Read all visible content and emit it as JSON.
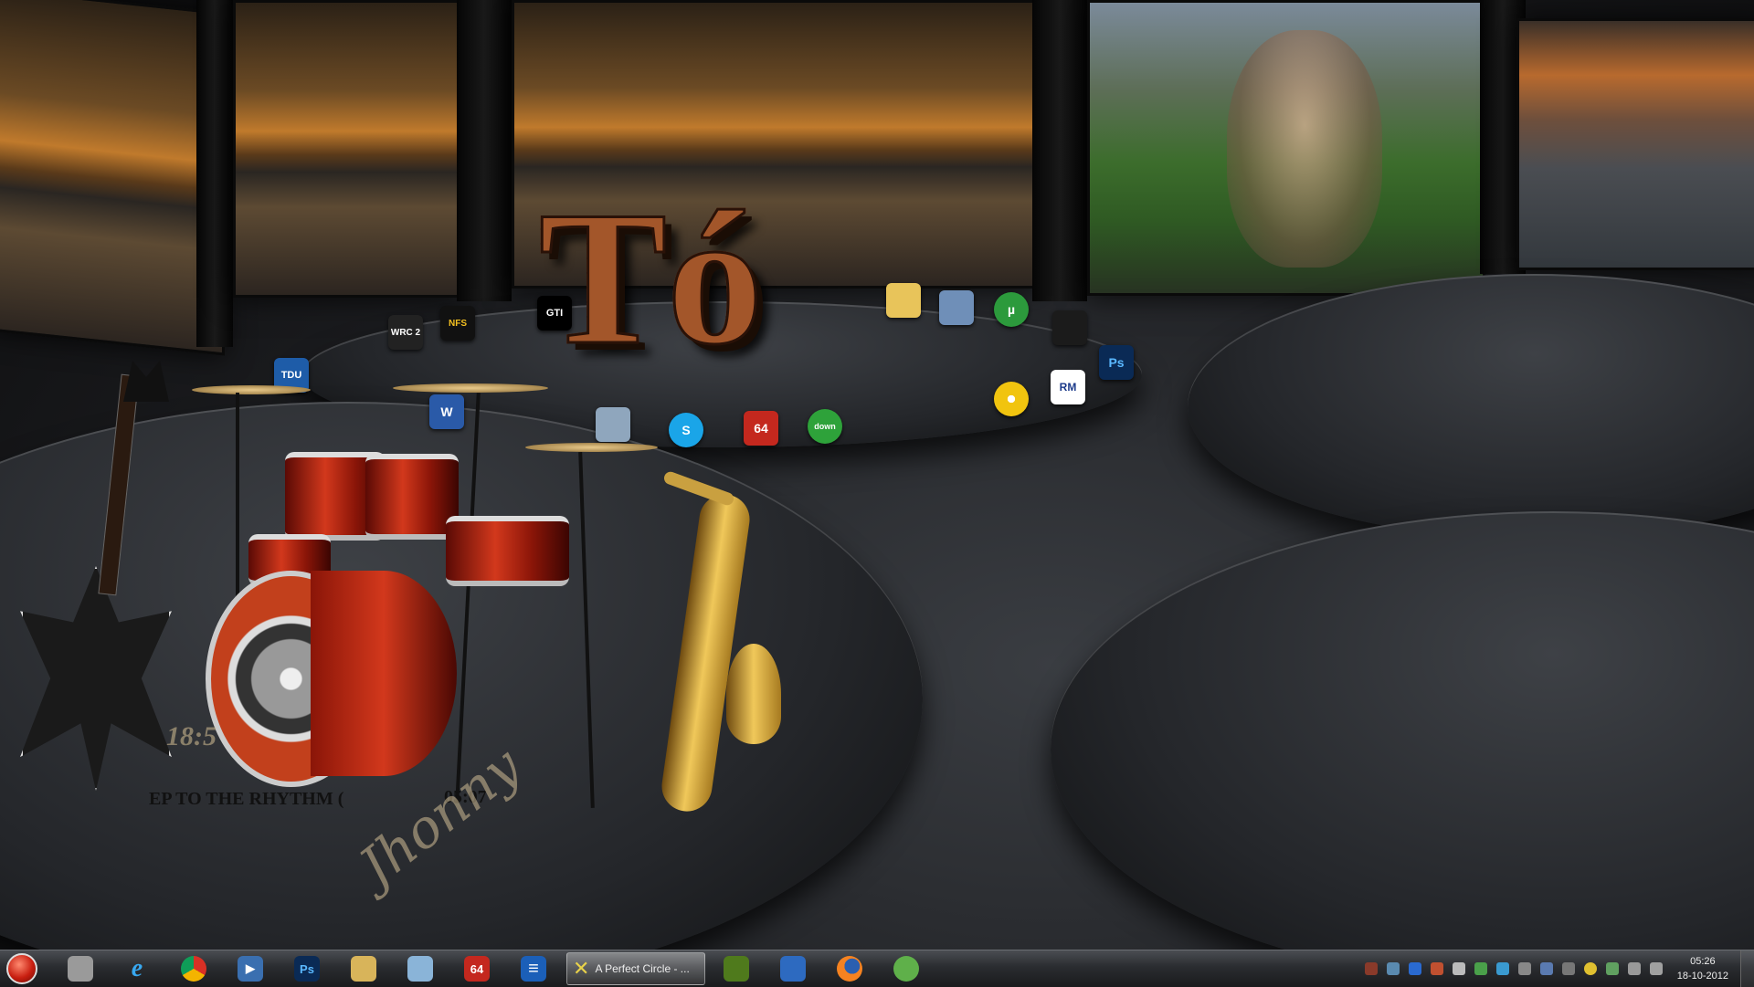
{
  "wallpaper": {
    "logo_text": "Tó",
    "clock_gadget_time": "05:07",
    "music_gadget_text": "EP TO THE RHYTHM (",
    "music_gadget_number": "18:5",
    "script_signature": "Jhonny"
  },
  "desktop_icons": [
    {
      "name": "tdu-icon",
      "label": "TDU"
    },
    {
      "name": "wrc2-icon",
      "label": "WRC 2"
    },
    {
      "name": "nfs-icon",
      "label": "NFS"
    },
    {
      "name": "gti-icon",
      "label": "GTI"
    },
    {
      "name": "word-icon",
      "label": "W"
    },
    {
      "name": "folder-icon",
      "label": ""
    },
    {
      "name": "network-computer-icon",
      "label": ""
    },
    {
      "name": "utorrent-icon",
      "label": "µ"
    },
    {
      "name": "nero-icon",
      "label": ""
    },
    {
      "name": "photoshop-icon",
      "label": "Ps"
    },
    {
      "name": "realmedia-icon",
      "label": "RM"
    },
    {
      "name": "dvd-icon",
      "label": ""
    },
    {
      "name": "skype-icon",
      "label": "S"
    },
    {
      "name": "aida64-icon",
      "label": "64"
    },
    {
      "name": "download-icon",
      "label": "down"
    },
    {
      "name": "recycle-bin-icon",
      "label": ""
    }
  ],
  "taskbar": {
    "active_task_label": "A Perfect Circle - ...",
    "pinned": [
      {
        "name": "start-orb-icon",
        "label": ""
      },
      {
        "name": "library-icon",
        "label": ""
      },
      {
        "name": "internet-explorer-icon",
        "label": "e"
      },
      {
        "name": "chrome-icon",
        "label": ""
      },
      {
        "name": "media-player-icon",
        "label": "▶"
      },
      {
        "name": "photoshop-taskbar-icon",
        "label": "Ps"
      },
      {
        "name": "explorer-folder-icon",
        "label": ""
      },
      {
        "name": "notes-icon",
        "label": ""
      },
      {
        "name": "aida64-taskbar-icon",
        "label": "64"
      },
      {
        "name": "stack-icon",
        "label": "≡"
      },
      {
        "name": "winamp-icon",
        "label": ""
      },
      {
        "name": "app-store-icon",
        "label": ""
      },
      {
        "name": "firefox-icon",
        "label": ""
      },
      {
        "name": "messenger-icon",
        "label": ""
      }
    ],
    "clock_time": "05:26",
    "clock_date": "18-10-2012"
  }
}
